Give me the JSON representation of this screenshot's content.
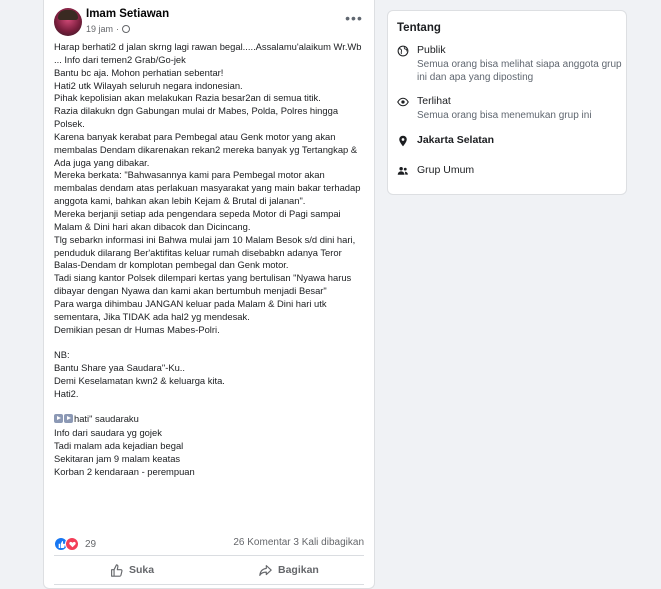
{
  "post": {
    "author": "Imam Setiawan",
    "time": "19 jam",
    "time_sep": "·",
    "more_label": "•••",
    "body_before_icons": "Harap berhati2 d jalan skrng lagi rawan begal.....Assalamu'alaikum Wr.Wb\n... Info dari temen2 Grab/Go-jek\nBantu bc aja. Mohon perhatian sebentar!\nHati2 utk Wilayah seluruh negara indonesian.\nPihak kepolisian akan melakukan Razia besar2an di semua titik.\nRazia dilakukn dgn Gabungan mulai dr Mabes, Polda, Polres hingga Polsek.\nKarena banyak kerabat para Pembegal atau Genk motor yang akan membalas Dendam dikarenakan rekan2 mereka banyak yg Tertangkap & Ada juga yang dibakar.\nMereka berkata: \"Bahwasannya kami para Pembegal motor akan membalas dendam atas perlakuan masyarakat yang main bakar terhadap anggota kami, bahkan akan lebih Kejam & Brutal di jalanan\".\nMereka berjanji setiap ada pengendara sepeda Motor di Pagi sampai Malam & Dini hari akan dibacok dan Dicincang.\nTlg sebarkn informasi ini Bahwa mulai jam 10 Malam Besok s/d dini hari, penduduk dilarang Ber'aktifitas keluar rumah disebabkn adanya Teror Balas-Dendam dr komplotan pembegal dan Genk motor.\nTadi siang kantor Polsek dilempari kertas yang bertulisan \"Nyawa harus dibayar dengan Nyawa dan kami akan bertumbuh menjadi Besar\"\nPara warga dihimbau JANGAN keluar pada Malam & Dini hari utk sementara, Jika TIDAK ada hal2 yg mendesak.\nDemikian pesan dr Humas Mabes-Polri.\n\nNB:\nBantu Share yaa Saudara\"-Ku..\nDemi Keselamatan kwn2 & keluarga kita.\nHati2.\n\n",
    "body_after_icons": "hati\" saudaraku\nInfo dari saudara yg gojek\nTadi malam ada kejadian begal\nSekitaran jam 9 malam keatas\nKorban 2 kendaraan - perempuan",
    "reaction_count": "29",
    "comments_shares": "26 Komentar 3 Kali dibagikan",
    "like_label": "Suka",
    "share_label": "Bagikan",
    "colors": {
      "like": "#1877f2",
      "love": "#f33e58"
    }
  },
  "about": {
    "title": "Tentang",
    "items": [
      {
        "icon": "globe-icon",
        "head": "Publik",
        "desc": "Semua orang bisa melihat siapa anggota grup ini dan apa yang diposting"
      },
      {
        "icon": "eye-icon",
        "head": "Terlihat",
        "desc": "Semua orang bisa menemukan grup ini"
      },
      {
        "icon": "location-pin-icon",
        "head": "Jakarta Selatan",
        "desc": ""
      },
      {
        "icon": "people-icon",
        "head": "Grup Umum",
        "desc": ""
      }
    ]
  }
}
